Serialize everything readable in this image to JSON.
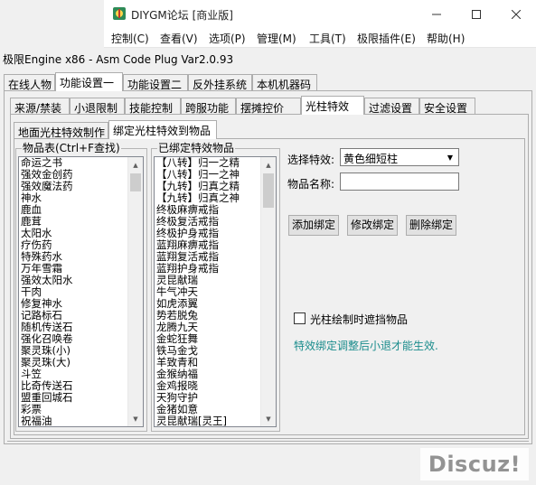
{
  "outer_window": {
    "title": "DIYGM论坛 [商业版]",
    "menu": [
      "控制(C)",
      "查看(V)",
      "选项(P)",
      "管理(M)",
      "工具(T)",
      "极限插件(E)",
      "帮助(H)"
    ]
  },
  "plugin": {
    "title": "极限Engine x86 - Asm Code Plug Var2.0.93",
    "main_tabs": [
      "在线人物",
      "功能设置一",
      "功能设置二",
      "反外挂系统",
      "本机机器码"
    ],
    "sub_tabs": [
      "来源/禁装",
      "小退限制",
      "技能控制",
      "跨服功能",
      "摆摊控价",
      "光柱特效",
      "过滤设置",
      "安全设置"
    ],
    "inner_tabs": [
      "地面光柱特效制作",
      "绑定光柱特效到物品"
    ],
    "items_group_label": "物品表(Ctrl+F查找)",
    "items": [
      "命运之书",
      "强效金创药",
      "强效魔法药",
      "神水",
      "鹿血",
      "鹿茸",
      "太阳水",
      "疗伤药",
      "特殊药水",
      "万年雪霜",
      "强效太阳水",
      "干肉",
      "修复神水",
      "记路标石",
      "随机传送石",
      "强化召唤卷",
      "聚灵珠(小)",
      "聚灵珠(大)",
      "斗笠",
      "比奇传送石",
      "盟重回城石",
      "彩票",
      "祝福油"
    ],
    "bound_group_label": "已绑定特效物品",
    "bound_items": [
      "【八转】归一之精",
      "【八转】归一之神",
      "【九转】归真之精",
      "【九转】归真之神",
      "终极麻痹戒指",
      "终极复活戒指",
      "终极护身戒指",
      "蓝翔麻痹戒指",
      "蓝翔复活戒指",
      "蓝翔护身戒指",
      "灵昆献瑞",
      "牛气冲天",
      "如虎添翼",
      "势若脱兔",
      "龙腾九天",
      "金蛇狂舞",
      "铁马金戈",
      "羊致青和",
      "金猴纳福",
      "金鸡报晓",
      "天狗守护",
      "金猪如意",
      "灵昆献瑞[灵王]"
    ],
    "effect_label": "选择特效:",
    "effect_value": "黄色细短柱",
    "item_name_label": "物品名称:",
    "item_name_value": "",
    "add_button": "添加绑定",
    "modify_button": "修改绑定",
    "delete_button": "删除绑定",
    "checkbox_label": "光柱绘制时遮挡物品",
    "checkbox_checked": false,
    "hint_text": "特效绑定调整后小退才能生效."
  },
  "watermark": "Discuz!",
  "colors": {
    "hint": "#1a8c8c",
    "watermark": "#8a8a8a"
  }
}
